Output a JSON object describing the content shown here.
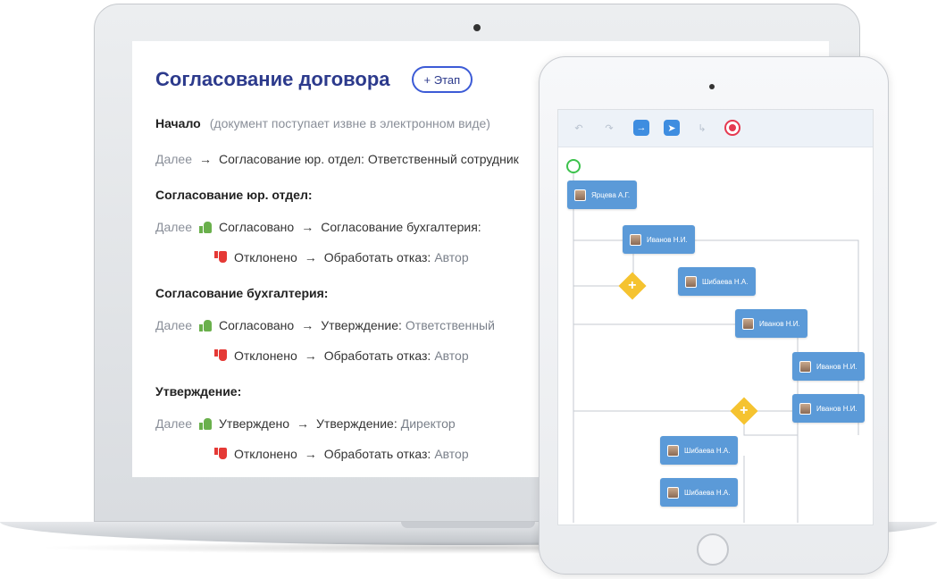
{
  "document": {
    "title": "Согласование договора",
    "add_stage_label": "+ Этап",
    "start_label": "Начало",
    "start_note": "(документ поступает извне в электронном виде)",
    "next_label": "Далее",
    "arrow": "→",
    "first_next": "Согласование юр. отдел: Ответственный сотрудник",
    "stages": [
      {
        "title": "Согласование юр. отдел:",
        "approve_label": "Согласовано",
        "approve_target": "Согласование бухгалтерия:",
        "approve_assignee": "",
        "reject_label": "Отклонено",
        "reject_target": "Обработать отказ:",
        "reject_assignee": "Автор"
      },
      {
        "title": "Согласование бухгалтерия:",
        "approve_label": "Согласовано",
        "approve_target": "Утверждение:",
        "approve_assignee": "Ответственный",
        "reject_label": "Отклонено",
        "reject_target": "Обработать отказ:",
        "reject_assignee": "Автор"
      },
      {
        "title": "Утверждение:",
        "approve_label": "Утверждено",
        "approve_target": "Утверждение:",
        "approve_assignee": "Директор",
        "reject_label": "Отклонено",
        "reject_target": "Обработать отказ:",
        "reject_assignee": "Автор"
      }
    ]
  },
  "tablet": {
    "toolbar": {
      "undo_icon": "undo-icon",
      "redo_icon": "redo-icon",
      "arrow_icon": "arrow-right-icon",
      "send_icon": "send-icon",
      "branch_icon": "branch-icon",
      "record_icon": "record-icon"
    },
    "nodes": [
      {
        "name": "Ярцева А.Г."
      },
      {
        "name": "Иванов Н.И."
      },
      {
        "name": "Шибаева Н.А."
      },
      {
        "name": "Иванов Н.И."
      },
      {
        "name": "Иванов Н.И."
      },
      {
        "name": "Иванов Н.И."
      },
      {
        "name": "Шибаева Н.А."
      },
      {
        "name": "Шибаева Н.А."
      }
    ],
    "colors": {
      "node": "#5b9ad8",
      "gateway": "#f5c330",
      "start": "#3cc24c",
      "record": "#e53950"
    }
  }
}
